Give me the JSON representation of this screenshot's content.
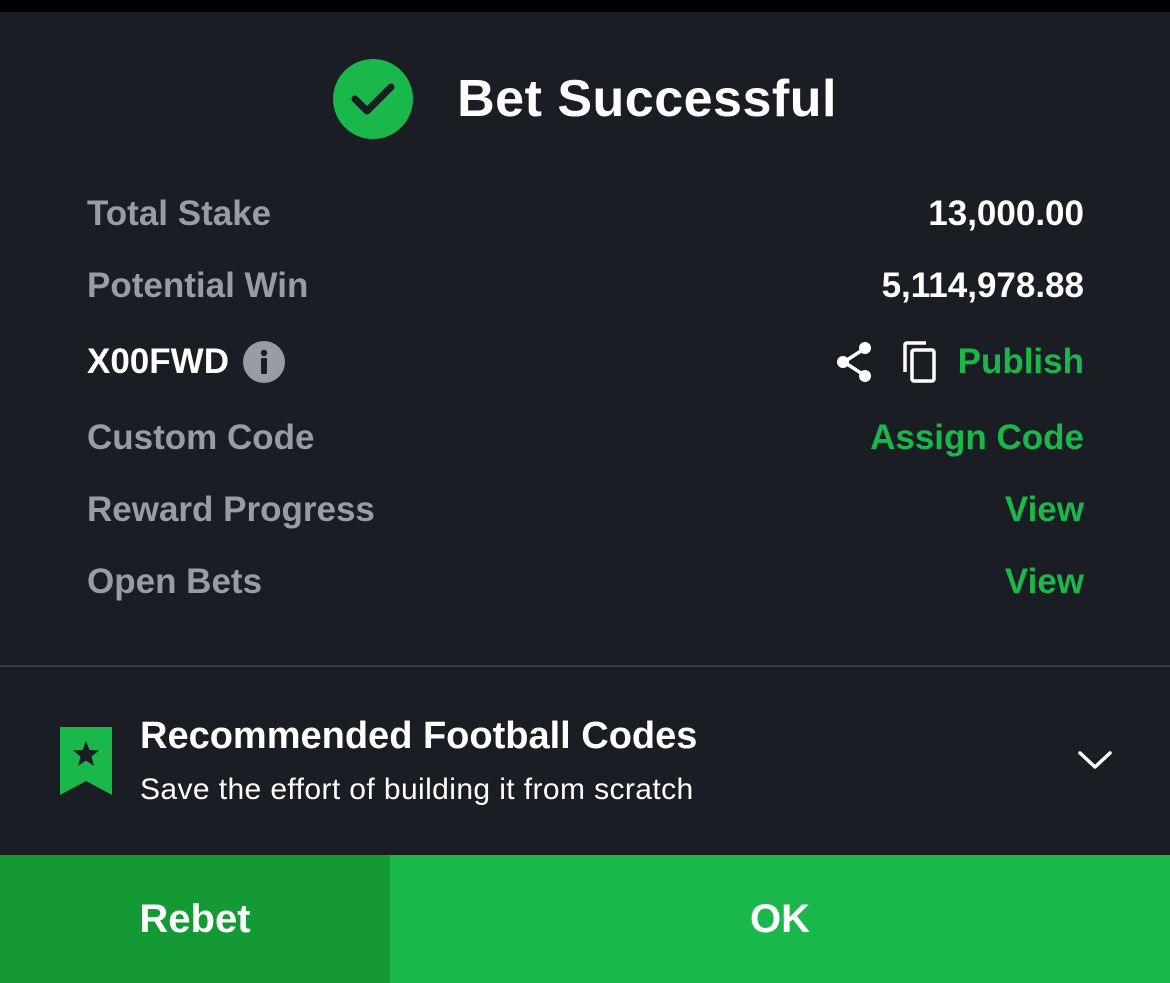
{
  "header": {
    "icon": "check-circle-icon",
    "title": "Bet Successful"
  },
  "summary": {
    "total_stake_label": "Total Stake",
    "total_stake_value": "13,000.00",
    "potential_win_label": "Potential Win",
    "potential_win_value": "5,114,978.88",
    "booking_code": "X00FWD",
    "booking_code_info_icon": "info-icon",
    "share_icon": "share-icon",
    "copy_icon": "copy-icon",
    "publish_label": "Publish",
    "custom_code_label": "Custom Code",
    "custom_code_action": "Assign Code",
    "reward_progress_label": "Reward Progress",
    "reward_progress_action": "View",
    "open_bets_label": "Open Bets",
    "open_bets_action": "View"
  },
  "recommended": {
    "icon": "bookmark-star-icon",
    "title": "Recommended Football Codes",
    "subtitle": "Save the effort of building it from scratch",
    "toggle_icon": "chevron-down-icon"
  },
  "footer": {
    "rebet_label": "Rebet",
    "ok_label": "OK"
  },
  "colors": {
    "background": "#1b1d24",
    "accent_green": "#1ab84b",
    "dark_green": "#139a34",
    "muted_text": "#9a9ca4"
  }
}
